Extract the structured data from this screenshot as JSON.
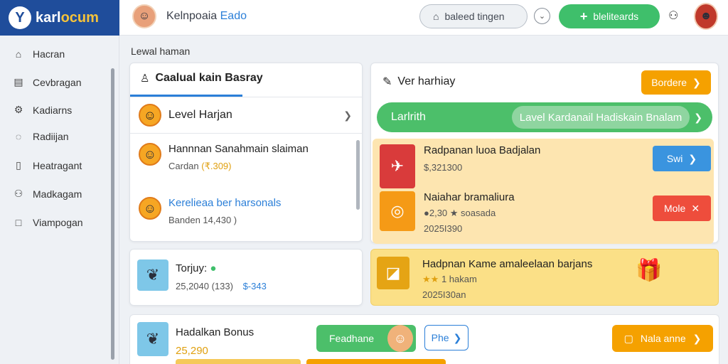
{
  "brand": {
    "logo_glyph": "Y",
    "name_main": "karl",
    "name_accent": "ocum"
  },
  "header": {
    "title_main": "Kelnpoaia ",
    "title_blue": "Eado",
    "search_label": "baleed tingen",
    "primary_button_label": "bleliteards",
    "primary_button_color": "#3fbf6b"
  },
  "sidebar": {
    "items": [
      {
        "icon": "home-icon",
        "label": "Hacran"
      },
      {
        "icon": "document-icon",
        "label": "Cevbragan"
      },
      {
        "icon": "gear-icon",
        "label": "Kadiarns"
      },
      {
        "icon": "chat-icon",
        "label": "Radiijan"
      },
      {
        "icon": "clipboard-icon",
        "label": "Heatragant"
      },
      {
        "icon": "users-icon",
        "label": "Madkagam"
      },
      {
        "icon": "square-icon",
        "label": "Viampogan"
      }
    ]
  },
  "section_label": "Lewal haman",
  "level_card": {
    "title": "Caalual kain Basray",
    "selector_label": "Level Harjan",
    "entries": [
      {
        "title": "Hannnan Sanahmain slaiman",
        "sub_main": "Cardan ",
        "sub_gold": "(₹.309)"
      },
      {
        "title": "Kerelieaa ber harsonals",
        "sub_main": "Banden 14,430 )",
        "sub_gold": ""
      }
    ]
  },
  "today_card": {
    "title": "Torjuy: ",
    "title_badge": "●",
    "meta": "25,2040 (133)",
    "amount": "$-343"
  },
  "right_card": {
    "title": "Ver harhiay",
    "header_button": "Bordere",
    "bar_label": "Larlrith",
    "bar_pill": "Lavel Kardanail Hadiskain Bnalam",
    "offers": [
      {
        "title": "Radpanan luoa Badjalan",
        "line1": "$,321300",
        "line2": "",
        "button": "Swi",
        "button_color": "#3a94df"
      },
      {
        "title": "Naiahar bramaliura",
        "line1": "●2,30 ★ soasada",
        "line2": "2025I390",
        "button": "Mole",
        "button_color": "#ee4d3c"
      }
    ]
  },
  "promo_card": {
    "title": "Hadpnan Kame amaleelaan barjans",
    "line1": "1 hakam",
    "line2": "2025I30an"
  },
  "bonus_card": {
    "title": "Hadalkan Bonus",
    "amount": "25,290",
    "green_button": "Feadhane",
    "outline_button": "Phe",
    "orange_button": "Nala anne"
  }
}
